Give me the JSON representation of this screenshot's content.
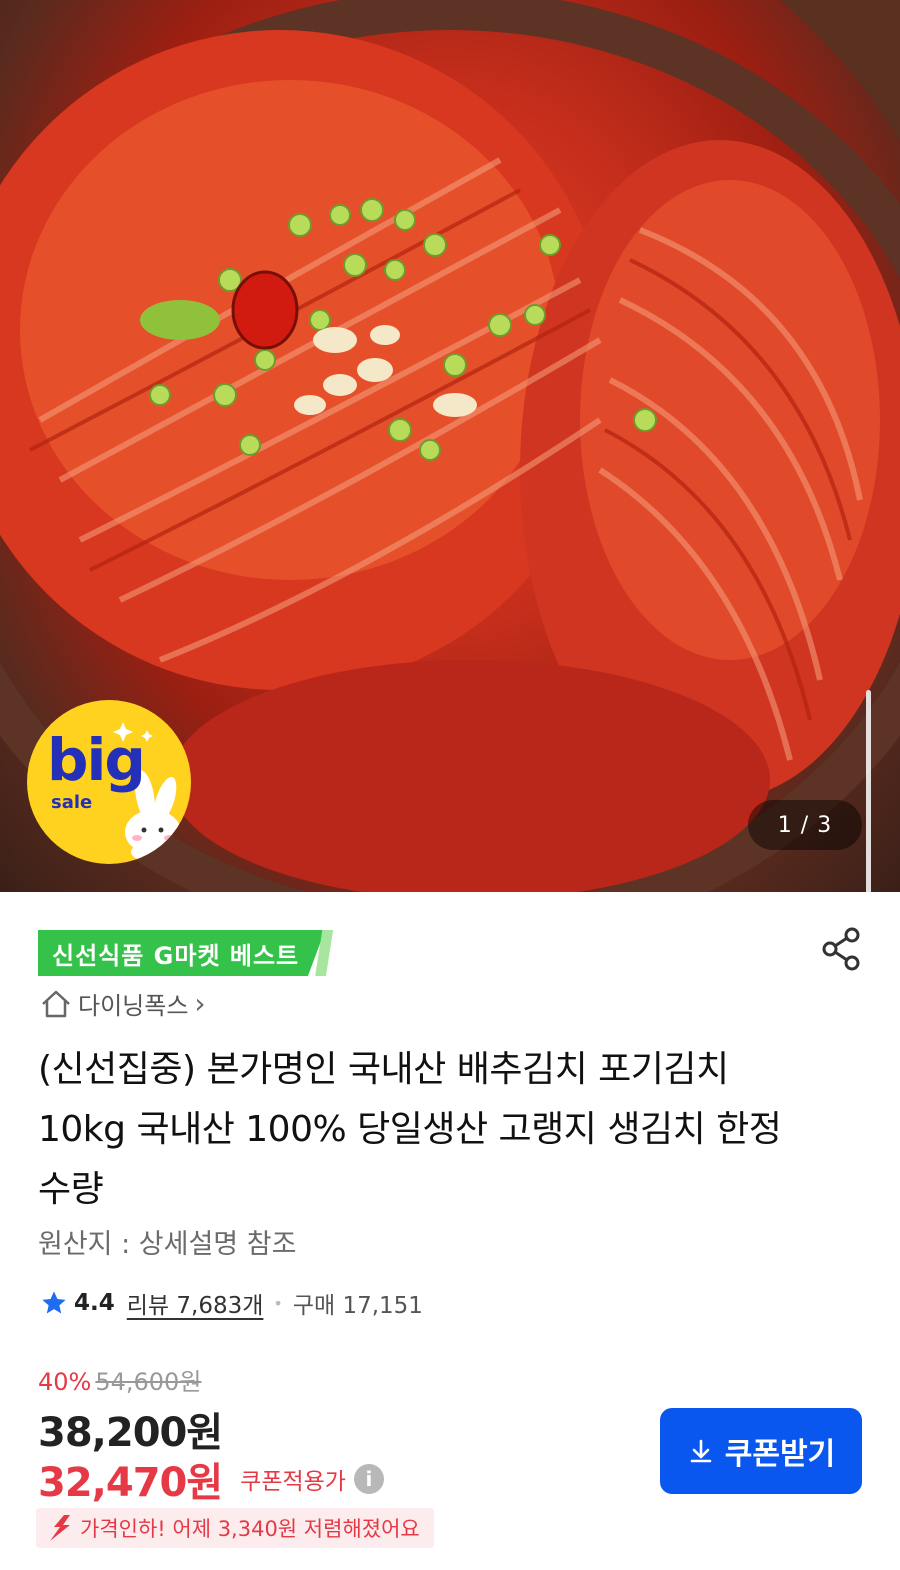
{
  "gallery": {
    "counter": "1 / 3",
    "promo_sticker": {
      "big": "big",
      "sale": "sale"
    }
  },
  "badge": {
    "label": "신선식품 G마켓 베스트"
  },
  "store": {
    "name": "다이닝폭스",
    "chevron": "›"
  },
  "product": {
    "title": "(신선집중) 본가명인 국내산 배추김치 포기김치 10kg 국내산 100% 당일생산 고랭지 생김치 한정수량",
    "origin": "원산지 : 상세설명 참조"
  },
  "rating": {
    "score": "4.4",
    "reviews": "리뷰 7,683개",
    "purchases": "구매 17,151"
  },
  "pricing": {
    "discount_rate": "40%",
    "original_price": "54,600원",
    "price": "38,200원",
    "coupon_price": "32,470원",
    "coupon_label": "쿠폰적용가",
    "price_drop_note": "가격인하! 어제 3,340원 저렴해졌어요"
  },
  "actions": {
    "coupon_button": "쿠폰받기"
  },
  "icons": {
    "share": "share-icon",
    "home": "home-icon",
    "star": "star-icon",
    "info": "info-icon",
    "download": "download-icon",
    "price_down": "price-down-arrow-icon"
  },
  "colors": {
    "badge_green": "#35c24a",
    "accent_red": "#e63946",
    "button_blue": "#0a57f0",
    "star_blue": "#1f6cf0"
  }
}
